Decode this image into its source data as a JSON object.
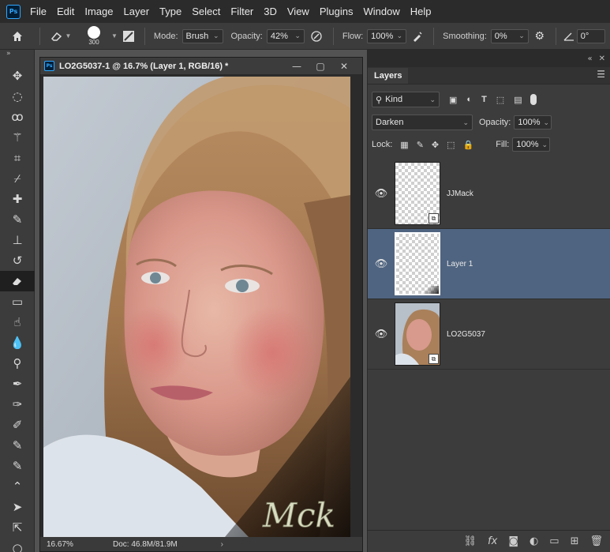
{
  "menu": [
    "File",
    "Edit",
    "Image",
    "Layer",
    "Type",
    "Select",
    "Filter",
    "3D",
    "View",
    "Plugins",
    "Window",
    "Help"
  ],
  "app_logo": "Ps",
  "options": {
    "brush_size": "300",
    "mode_label": "Mode:",
    "mode_value": "Brush",
    "opacity_label": "Opacity:",
    "opacity_value": "42%",
    "flow_label": "Flow:",
    "flow_value": "100%",
    "smoothing_label": "Smoothing:",
    "smoothing_value": "0%",
    "angle_value": "0°"
  },
  "document": {
    "title": "LO2G5037-1 @ 16.7% (Layer 1, RGB/16) *",
    "zoom": "16.67%",
    "doc_info": "Doc: 46.8M/81.9M",
    "watermark": "JJMack"
  },
  "layers_panel": {
    "tab": "Layers",
    "filter_kind": "Kind",
    "blend_mode": "Darken",
    "opacity_label": "Opacity:",
    "opacity_value": "100%",
    "lock_label": "Lock:",
    "fill_label": "Fill:",
    "fill_value": "100%",
    "layers": [
      {
        "name": "JJMack",
        "selected": false
      },
      {
        "name": "Layer 1",
        "selected": true
      },
      {
        "name": "LO2G5037",
        "selected": false
      }
    ]
  },
  "colors": {
    "selected_layer": "#4f6480",
    "app_bg": "#535353",
    "panel_bg": "#3c3c3c"
  }
}
